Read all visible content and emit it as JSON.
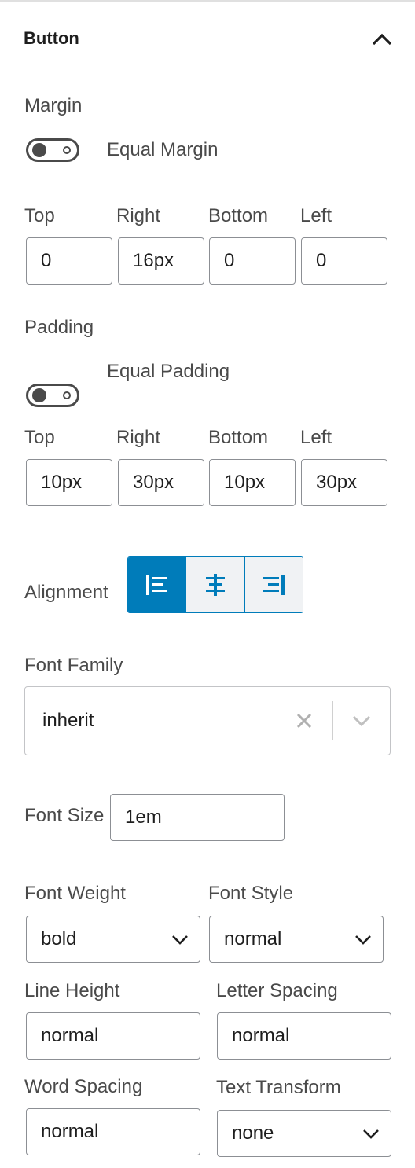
{
  "panel": {
    "title": "Button",
    "collapse_icon": "chevron-up-icon"
  },
  "margin": {
    "label": "Margin",
    "equal_toggle": {
      "label": "Equal Margin",
      "state": "off"
    },
    "sides": [
      {
        "label": "Top",
        "value": "0"
      },
      {
        "label": "Right",
        "value": "16px"
      },
      {
        "label": "Bottom",
        "value": "0"
      },
      {
        "label": "Left",
        "value": "0"
      }
    ]
  },
  "padding": {
    "label": "Padding",
    "equal_toggle": {
      "label": "Equal Padding",
      "state": "off"
    },
    "sides": [
      {
        "label": "Top",
        "value": "10px"
      },
      {
        "label": "Right",
        "value": "30px"
      },
      {
        "label": "Bottom",
        "value": "10px"
      },
      {
        "label": "Left",
        "value": "30px"
      }
    ]
  },
  "alignment": {
    "label": "Alignment",
    "options": [
      "align-left-icon",
      "align-center-icon",
      "align-right-icon"
    ],
    "selected": "align-left-icon"
  },
  "font_family": {
    "label": "Font Family",
    "value": "inherit"
  },
  "font_size": {
    "label": "Font Size",
    "value": "1em"
  },
  "font_weight": {
    "label": "Font Weight",
    "value": "bold"
  },
  "font_style": {
    "label": "Font Style",
    "value": "normal"
  },
  "line_height": {
    "label": "Line Height",
    "value": "normal"
  },
  "letter_spacing": {
    "label": "Letter Spacing",
    "value": "normal"
  },
  "word_spacing": {
    "label": "Word Spacing",
    "value": "normal"
  },
  "text_transform": {
    "label": "Text Transform",
    "value": "none"
  },
  "colors": {
    "accent": "#007cba",
    "text": "#1e1e1e",
    "label": "#4a4a4a",
    "border": "#8c8f94"
  }
}
